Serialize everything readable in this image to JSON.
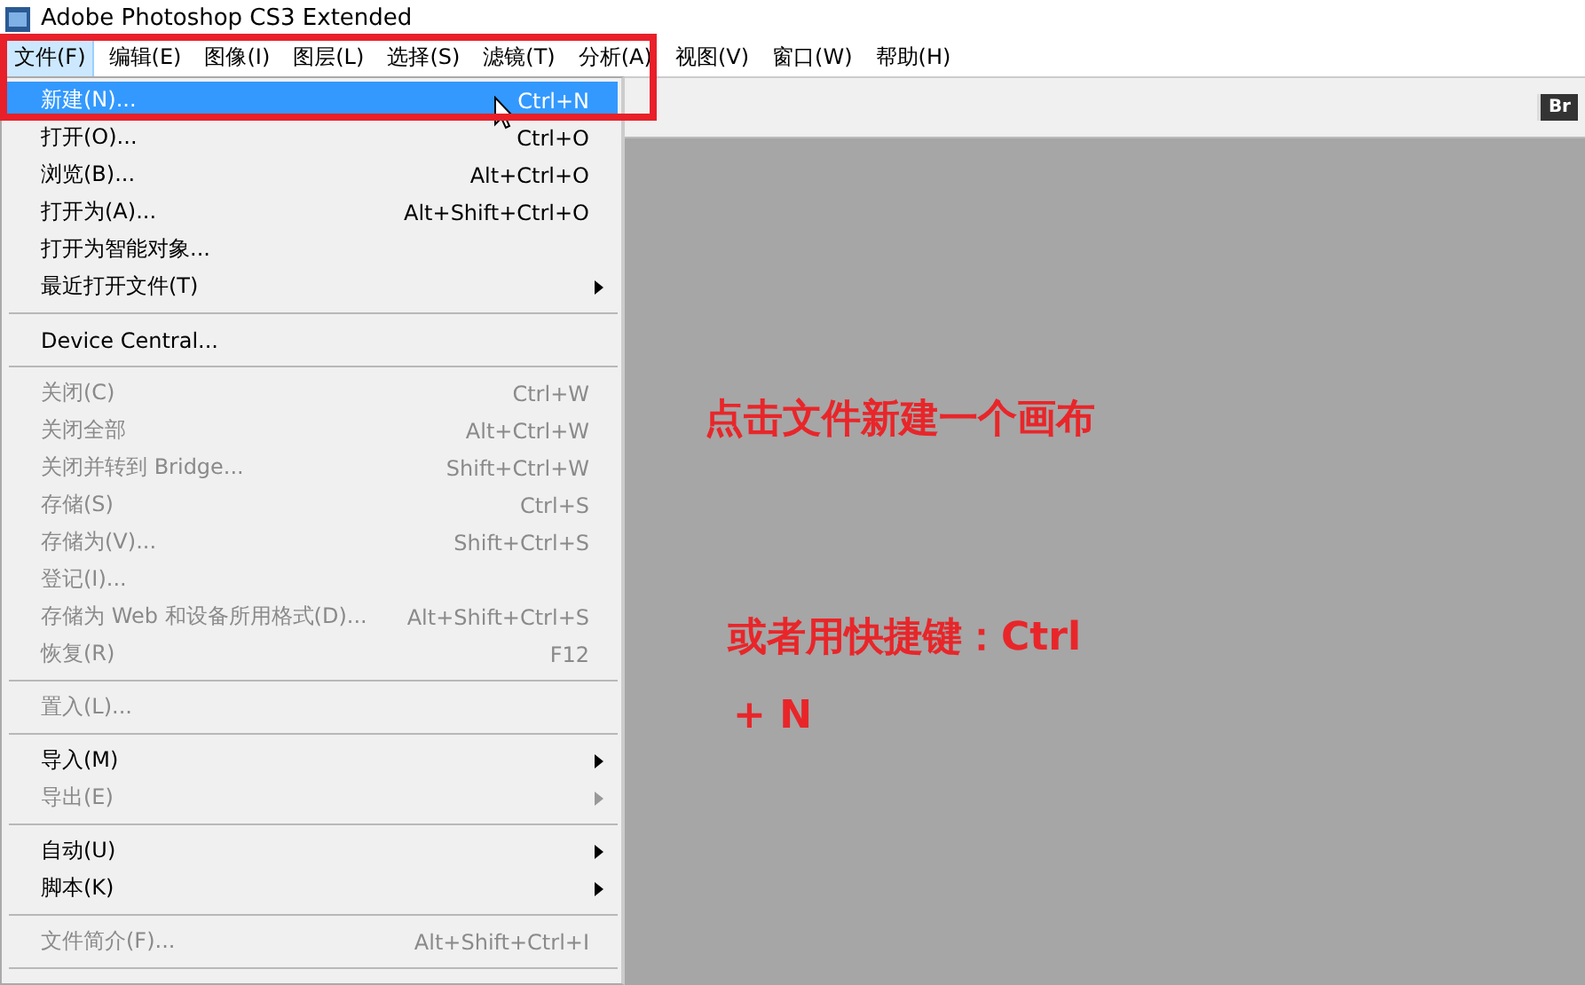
{
  "window": {
    "title": "Adobe Photoshop CS3 Extended"
  },
  "menu_bar": [
    {
      "label": "文件(F)",
      "selected": true
    },
    {
      "label": "编辑(E)",
      "selected": false
    },
    {
      "label": "图像(I)",
      "selected": false
    },
    {
      "label": "图层(L)",
      "selected": false
    },
    {
      "label": "选择(S)",
      "selected": false
    },
    {
      "label": "滤镜(T)",
      "selected": false
    },
    {
      "label": "分析(A)",
      "selected": false
    },
    {
      "label": "视图(V)",
      "selected": false
    },
    {
      "label": "窗口(W)",
      "selected": false
    },
    {
      "label": "帮助(H)",
      "selected": false
    }
  ],
  "toolbar": {
    "bridge_button": "Br"
  },
  "file_menu": [
    {
      "kind": "item",
      "label": "新建(N)...",
      "shortcut": "Ctrl+N",
      "selected": true,
      "disabled": false,
      "submenu": false
    },
    {
      "kind": "item",
      "label": "打开(O)...",
      "shortcut": "Ctrl+O",
      "selected": false,
      "disabled": false,
      "submenu": false
    },
    {
      "kind": "item",
      "label": "浏览(B)...",
      "shortcut": "Alt+Ctrl+O",
      "selected": false,
      "disabled": false,
      "submenu": false
    },
    {
      "kind": "item",
      "label": "打开为(A)...",
      "shortcut": "Alt+Shift+Ctrl+O",
      "selected": false,
      "disabled": false,
      "submenu": false
    },
    {
      "kind": "item",
      "label": "打开为智能对象...",
      "selected": false,
      "disabled": false,
      "submenu": false
    },
    {
      "kind": "item",
      "label": "最近打开文件(T)",
      "selected": false,
      "disabled": false,
      "submenu": true
    },
    {
      "kind": "separator"
    },
    {
      "kind": "item",
      "label": "Device Central...",
      "selected": false,
      "disabled": false,
      "submenu": false
    },
    {
      "kind": "separator"
    },
    {
      "kind": "item",
      "label": "关闭(C)",
      "shortcut": "Ctrl+W",
      "selected": false,
      "disabled": true,
      "submenu": false
    },
    {
      "kind": "item",
      "label": "关闭全部",
      "shortcut": "Alt+Ctrl+W",
      "selected": false,
      "disabled": true,
      "submenu": false
    },
    {
      "kind": "item",
      "label": "关闭并转到 Bridge...",
      "shortcut": "Shift+Ctrl+W",
      "selected": false,
      "disabled": true,
      "submenu": false
    },
    {
      "kind": "item",
      "label": "存储(S)",
      "shortcut": "Ctrl+S",
      "selected": false,
      "disabled": true,
      "submenu": false
    },
    {
      "kind": "item",
      "label": "存储为(V)...",
      "shortcut": "Shift+Ctrl+S",
      "selected": false,
      "disabled": true,
      "submenu": false
    },
    {
      "kind": "item",
      "label": "登记(I)...",
      "selected": false,
      "disabled": true,
      "submenu": false
    },
    {
      "kind": "item",
      "label": "存储为 Web 和设备所用格式(D)...",
      "shortcut": "Alt+Shift+Ctrl+S",
      "selected": false,
      "disabled": true,
      "submenu": false
    },
    {
      "kind": "item",
      "label": "恢复(R)",
      "shortcut": "F12",
      "selected": false,
      "disabled": true,
      "submenu": false
    },
    {
      "kind": "separator"
    },
    {
      "kind": "item",
      "label": "置入(L)...",
      "selected": false,
      "disabled": true,
      "submenu": false
    },
    {
      "kind": "separator"
    },
    {
      "kind": "item",
      "label": "导入(M)",
      "selected": false,
      "disabled": false,
      "submenu": true
    },
    {
      "kind": "item",
      "label": "导出(E)",
      "selected": false,
      "disabled": true,
      "submenu": true
    },
    {
      "kind": "separator"
    },
    {
      "kind": "item",
      "label": "自动(U)",
      "selected": false,
      "disabled": false,
      "submenu": true
    },
    {
      "kind": "item",
      "label": "脚本(K)",
      "selected": false,
      "disabled": false,
      "submenu": true
    },
    {
      "kind": "separator"
    },
    {
      "kind": "item",
      "label": "文件简介(F)...",
      "shortcut": "Alt+Shift+Ctrl+I",
      "selected": false,
      "disabled": true,
      "submenu": false
    },
    {
      "kind": "separator"
    }
  ],
  "annotations": [
    {
      "text": "点击文件新建一个画布"
    },
    {
      "text": "或者用快捷键：Ctrl"
    },
    {
      "text": "+ N"
    }
  ]
}
